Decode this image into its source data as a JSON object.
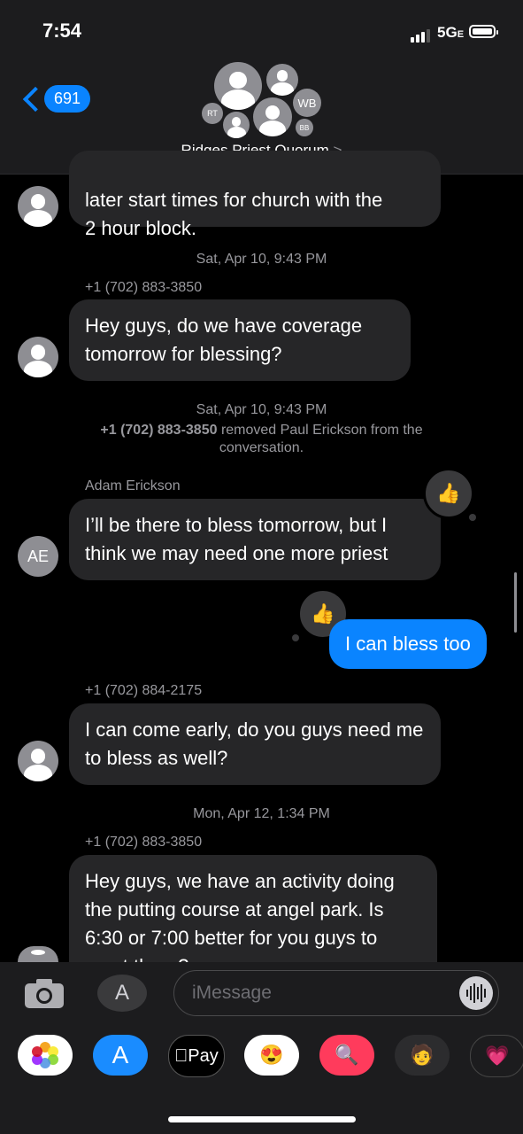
{
  "status": {
    "time": "7:54",
    "network": "5G",
    "network_suffix": "E"
  },
  "header": {
    "back_count": "691",
    "group_name": "Ridges Priest Quorum",
    "name_arrow": ">",
    "avatars": [
      "RT",
      "WB",
      "BB"
    ]
  },
  "messages": {
    "m0_text": "later start times for church with the\n2 hour block.",
    "ts1": "Sat, Apr 10, 9:43 PM",
    "m1_sender": "+1 (702) 883-3850",
    "m1_text": "Hey guys, do we have coverage tomorrow for blessing?",
    "ts2": "Sat, Apr 10, 9:43 PM",
    "ts2_actor": "+1 (702) 883-3850",
    "ts2_note": "removed Paul Erickson from the conversation.",
    "m2_sender": "Adam Erickson",
    "m2_avatar": "AE",
    "m2_text": "I’ll be there to bless tomorrow, but I think we may need one more priest",
    "m3_text": "I can bless too",
    "m4_sender": "+1 (702) 884-2175",
    "m4_text": "I can come early, do you guys need me to bless as well?",
    "ts3": "Mon, Apr 12, 1:34 PM",
    "m5_sender": "+1 (702) 883-3850",
    "m5_text": "Hey guys, we have an activity doing the putting course at angel park. Is 6:30 or 7:00 better for you guys to meet there?"
  },
  "input": {
    "placeholder": "iMessage"
  },
  "drawer": {
    "apple_pay": "Pay"
  },
  "colors": {
    "accent": "#0a84ff",
    "bubble_other": "#262628",
    "background": "#000000"
  }
}
